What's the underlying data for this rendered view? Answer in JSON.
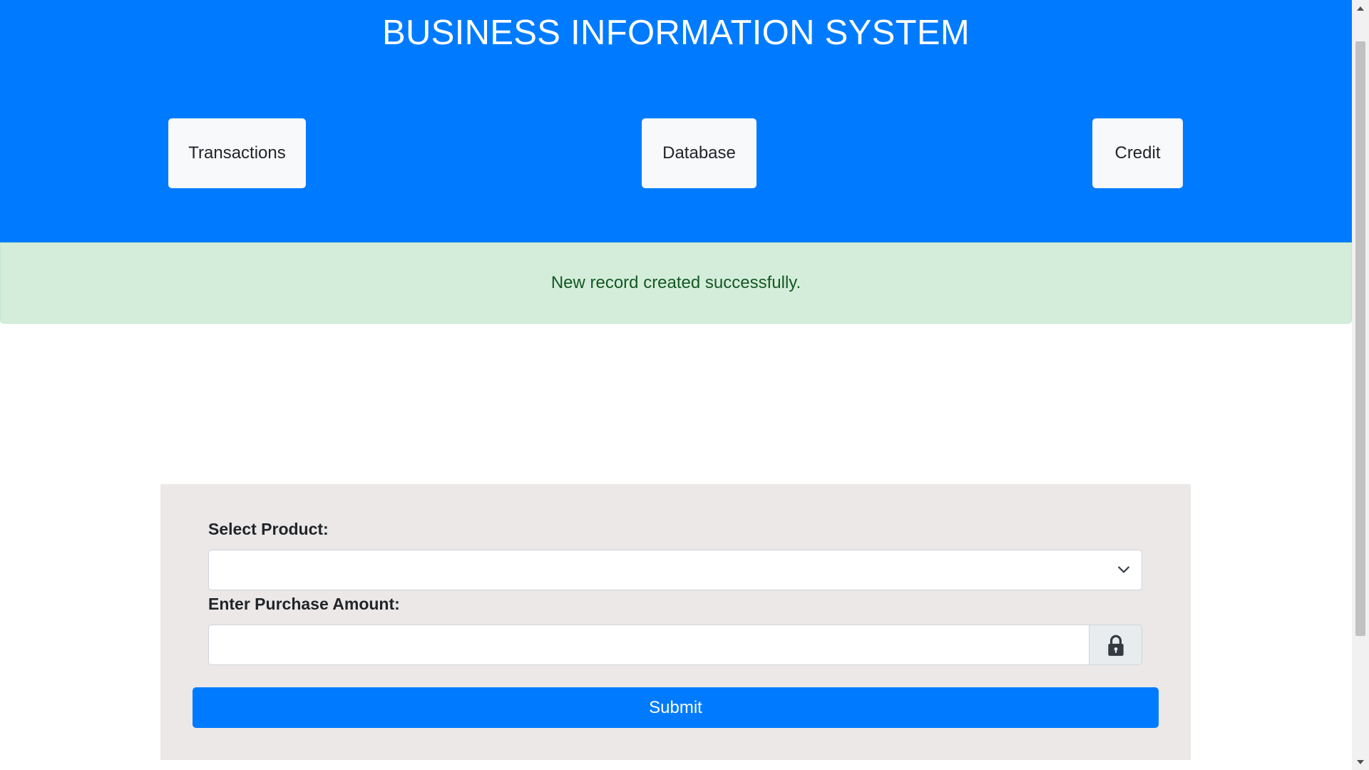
{
  "header": {
    "title": "BUSINESS INFORMATION SYSTEM",
    "background_color": "#007bff",
    "nav_buttons": [
      {
        "label": "Transactions"
      },
      {
        "label": "Database"
      },
      {
        "label": "Credit"
      }
    ]
  },
  "alert": {
    "message": "New record created successfully.",
    "type": "success",
    "background_color": "#d4edda",
    "text_color": "#155724"
  },
  "form": {
    "product_label": "Select Product:",
    "product_selected_value": "",
    "product_dropdown_icon": "chevron-down-icon",
    "amount_label": "Enter Purchase Amount:",
    "amount_value": "",
    "amount_addon_icon": "lock-icon",
    "submit_label": "Submit",
    "card_background_color": "#ece8e8",
    "submit_color": "#007bff"
  },
  "scrollbar": {
    "up_icon": "arrow-up-icon",
    "down_icon": "arrow-down-icon"
  }
}
